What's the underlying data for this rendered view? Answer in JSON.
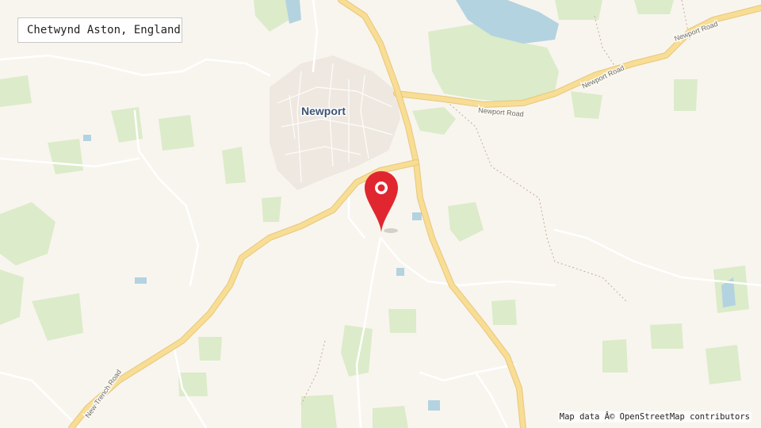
{
  "location_label": "Chetwynd Aston, England",
  "attribution": "Map data Â© OpenStreetMap contributors",
  "map": {
    "town_label": "Newport",
    "road_labels": {
      "newport_road_center": "Newport Road",
      "newport_road_east": "Newport Road",
      "newport_road_far_east": "Newport Road",
      "new_trench_road": "New Trench Road"
    },
    "marker": "location-pin-icon"
  },
  "colors": {
    "background": "#f8f5ef",
    "woodland": "#dcebc9",
    "water": "#b3d3e0",
    "major_road": "#f6d88b",
    "minor_road": "#ffffff",
    "marker": "#e0272f"
  }
}
